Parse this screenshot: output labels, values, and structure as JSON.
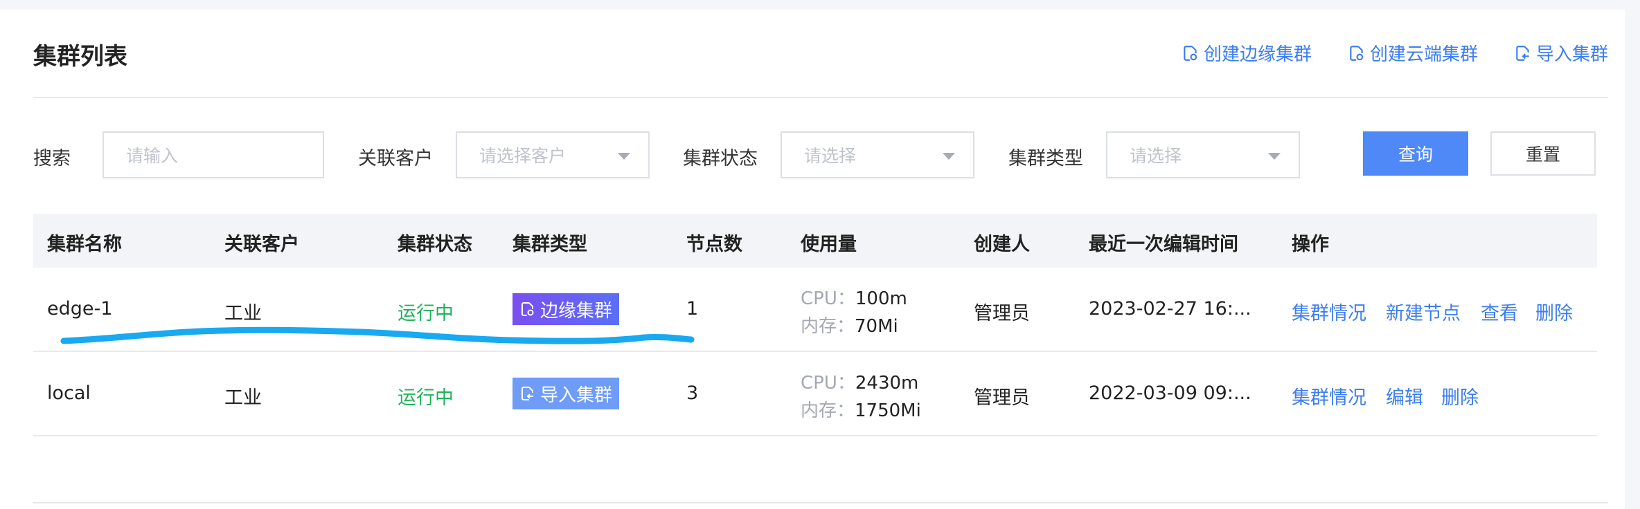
{
  "page": {
    "title": "集群列表",
    "actions": [
      {
        "label": "创建边缘集群",
        "icon": "cluster-add-icon"
      },
      {
        "label": "创建云端集群",
        "icon": "cluster-add-icon"
      },
      {
        "label": "导入集群",
        "icon": "import-icon"
      }
    ]
  },
  "filters": {
    "search_label": "搜索",
    "search_placeholder": "请输入",
    "customer_label": "关联客户",
    "customer_placeholder": "请选择客户",
    "status_label": "集群状态",
    "status_placeholder": "请选择",
    "type_label": "集群类型",
    "type_placeholder": "请选择",
    "query_button": "查询",
    "reset_button": "重置"
  },
  "table": {
    "headers": [
      "集群名称",
      "关联客户",
      "集群状态",
      "集群类型",
      "节点数",
      "使用量",
      "创建人",
      "最近一次编辑时间",
      "操作"
    ],
    "rows": [
      {
        "name": "edge-1",
        "customer": "工业",
        "status": "运行中",
        "type": "边缘集群",
        "nodes": "1",
        "cpu_key": "CPU：",
        "cpu": "100m",
        "mem_key": "内存：",
        "mem": "70Mi",
        "creator": "管理员",
        "edited": "2023-02-27 16:...",
        "ops": [
          "集群情况",
          "新建节点",
          "查看",
          "删除"
        ]
      },
      {
        "name": "local",
        "customer": "工业",
        "status": "运行中",
        "type": "导入集群",
        "nodes": "3",
        "cpu_key": "CPU：",
        "cpu": "2430m",
        "mem_key": "内存：",
        "mem": "1750Mi",
        "creator": "管理员",
        "edited": "2022-03-09 09:...",
        "ops": [
          "集群情况",
          "编辑",
          "删除"
        ]
      }
    ]
  },
  "colors": {
    "accent": "#3c7df0",
    "primary_button": "#4e89f7",
    "status_running": "#1fb35a",
    "annotation_stroke": "#19a9f0"
  }
}
